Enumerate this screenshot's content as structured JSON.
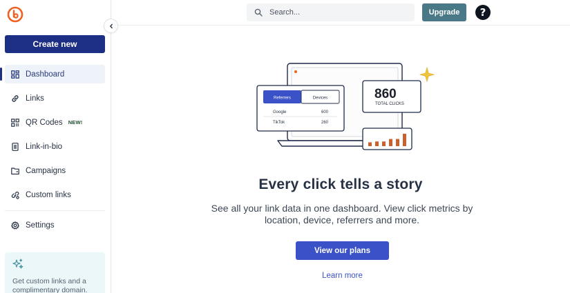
{
  "sidebar": {
    "create_label": "Create new",
    "items": [
      {
        "label": "Dashboard",
        "icon": "dashboard-icon",
        "active": true
      },
      {
        "label": "Links",
        "icon": "link-icon"
      },
      {
        "label": "QR Codes",
        "icon": "qr-code-icon",
        "badge": "NEW!"
      },
      {
        "label": "Link-in-bio",
        "icon": "link-in-bio-icon"
      },
      {
        "label": "Campaigns",
        "icon": "folder-icon"
      },
      {
        "label": "Custom links",
        "icon": "custom-link-icon"
      },
      {
        "label": "Settings",
        "icon": "gear-icon"
      }
    ],
    "promo_text": "Get custom links and a complimentary domain."
  },
  "topbar": {
    "search_placeholder": "Search...",
    "upgrade_label": "Upgrade",
    "help_label": "?"
  },
  "main": {
    "illustration": {
      "tab_referrers": "Referrers",
      "tab_devices": "Devices",
      "rows": [
        {
          "name": "Google",
          "value": "600"
        },
        {
          "name": "TikTok",
          "value": "260"
        }
      ],
      "total_value": "860",
      "total_label": "TOTAL CLICKS",
      "bar_levels": [
        0.28,
        0.34,
        0.34,
        0.52,
        0.52,
        0.9
      ]
    },
    "headline": "Every click tells a story",
    "description": "See all your link data in one dashboard. View click metrics by location, device, referrers and more.",
    "plans_label": "View our plans",
    "learn_more_label": "Learn more"
  },
  "colors": {
    "brand_navy": "#1d2f84",
    "upgrade_teal": "#497887",
    "cta_blue": "#3a51c8",
    "logo_orange": "#ee6123",
    "chart_orange": "#c8602f",
    "promo_bg": "#ebf7f8"
  }
}
